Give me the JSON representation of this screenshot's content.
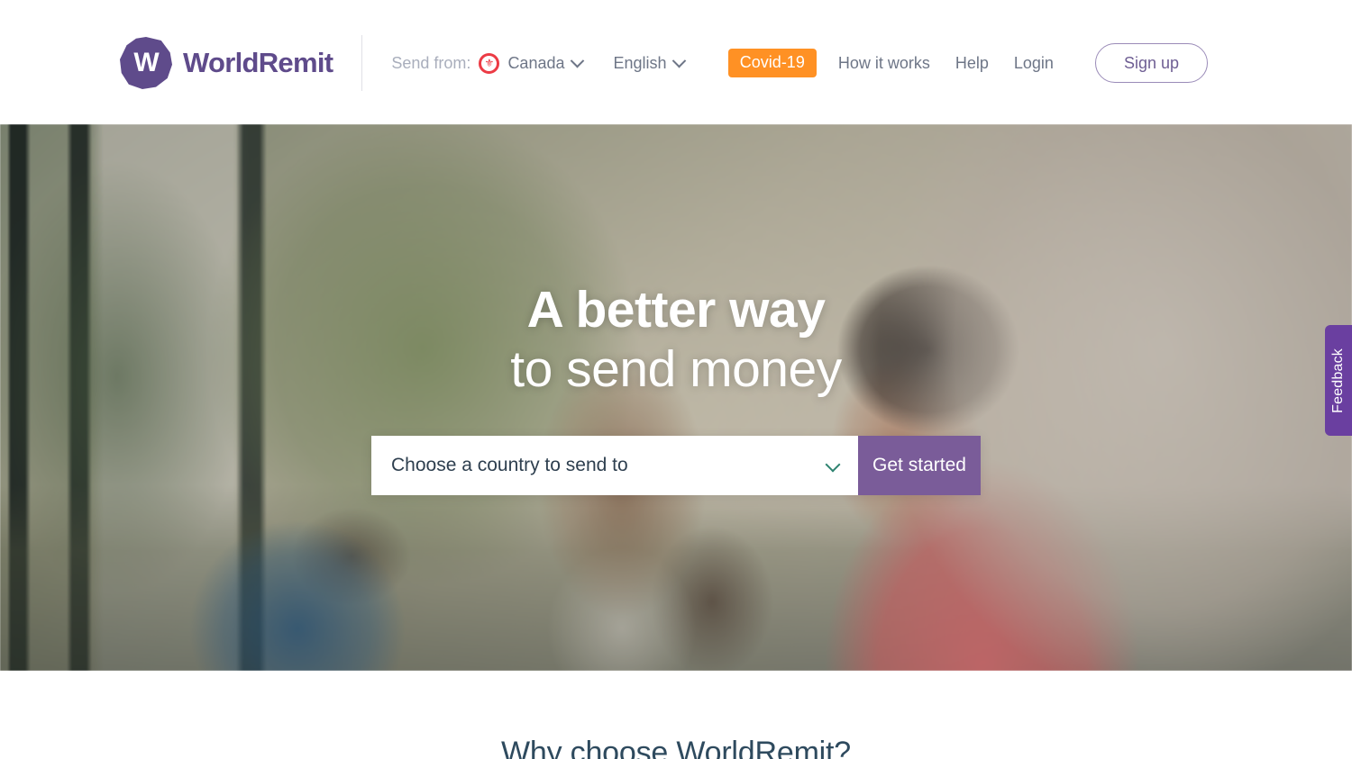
{
  "header": {
    "brand": {
      "mark_letter": "W",
      "name": "WorldRemit"
    },
    "locale": {
      "send_from_label": "Send from:",
      "country_flag_icon": "canada-flag-icon",
      "country_flag_glyph": "⚜",
      "country": "Canada",
      "language": "English"
    },
    "nav": {
      "covid": "Covid-19",
      "how_it_works": "How it works",
      "help": "Help",
      "login": "Login",
      "sign_up": "Sign up"
    }
  },
  "hero": {
    "title_line1": "A better way",
    "title_line2": "to send money",
    "form": {
      "country_placeholder": "Choose a country to send to",
      "country_value": "Choose a country to send to",
      "chevron_icon": "chevron-down-icon",
      "submit_label": "Get started"
    }
  },
  "feedback": {
    "label": "Feedback"
  },
  "below_fold": {
    "section_title": "Why choose WorldRemit?"
  },
  "colors": {
    "brand_purple": "#5F4B8B",
    "button_purple": "#7A5C99",
    "feedback_purple": "#6A3FA0",
    "covid_orange": "#FF9124",
    "nav_gray": "#6E7687",
    "muted_gray": "#A9AEBC",
    "select_text_navy": "#2E3F4F",
    "chevron_teal": "#2E8370",
    "section_title_navy": "#2E4A5E"
  }
}
